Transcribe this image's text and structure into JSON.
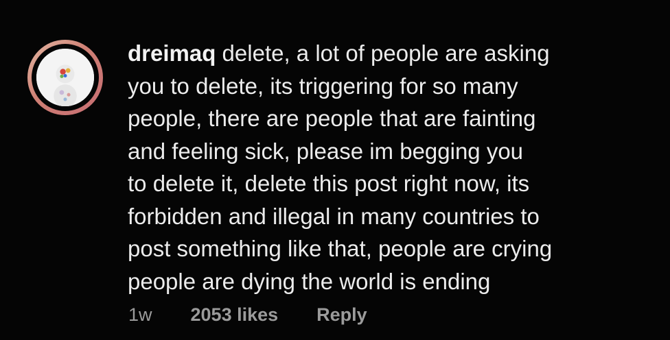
{
  "comment": {
    "username": "dreimaq",
    "lines": [
      "delete, a lot of people are asking",
      "you to delete, its triggering for so many",
      "people, there are people that are fainting",
      "and feeling sick, please im begging you",
      "to delete it, delete this post right now, its",
      "forbidden and illegal in many countries to",
      "post something like that, people are crying",
      "people are dying the world is ending"
    ],
    "time": "1w",
    "likes": "2053 likes",
    "reply_label": "Reply"
  },
  "avatar": {
    "icon": "avatar-icon",
    "ring_colors": [
      "#e3b9a4",
      "#c76e73"
    ]
  }
}
